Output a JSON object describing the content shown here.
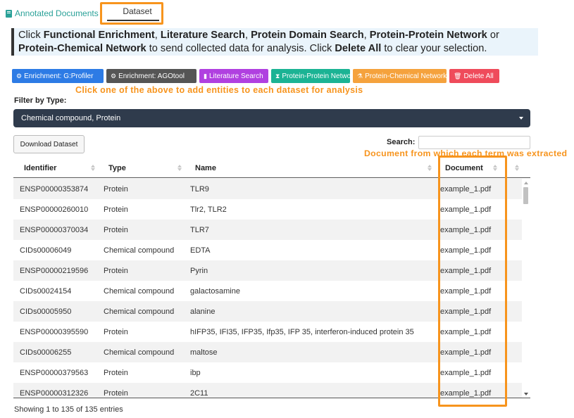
{
  "tabs": {
    "annotated_documents": "Annotated Documents",
    "dataset": "Dataset"
  },
  "info": {
    "p1": "Click ",
    "b1": "Functional Enrichment",
    "s1": ", ",
    "b2": "Literature Search",
    "s2": ", ",
    "b3": "Protein Domain Search",
    "s3": ", ",
    "b4": "Protein-Protein Network",
    "s4": " or ",
    "b5": "Protein-Chemical Network",
    "p2": " to send collected data for analysis. Click ",
    "b6": "Delete All",
    "p3": " to clear your selection."
  },
  "buttons": {
    "gprofiler": "Enrichment: G:Profiler",
    "agotool": "Enrichment: AGOtool",
    "literature": "Literature Search",
    "ppi": "Protein-Protein Network",
    "pci": "Protein-Chemical Network",
    "delete": "Delete All"
  },
  "hints": {
    "buttons": "Click one of the above to add entities to each dataset for analysis",
    "document": "Document from which each term was extracted"
  },
  "filter": {
    "label": "Filter by Type:",
    "value": "Chemical compound, Protein"
  },
  "download_label": "Download Dataset",
  "search_label": "Search:",
  "search_value": "",
  "columns": {
    "identifier": "Identifier",
    "type": "Type",
    "name": "Name",
    "document": "Document"
  },
  "rows": [
    {
      "id": "ENSP00000353874",
      "type": "Protein",
      "name": "TLR9",
      "doc": "example_1.pdf"
    },
    {
      "id": "ENSP00000260010",
      "type": "Protein",
      "name": "Tlr2, TLR2",
      "doc": "example_1.pdf"
    },
    {
      "id": "ENSP00000370034",
      "type": "Protein",
      "name": "TLR7",
      "doc": "example_1.pdf"
    },
    {
      "id": "CIDs00006049",
      "type": "Chemical compound",
      "name": "EDTA",
      "doc": "example_1.pdf"
    },
    {
      "id": "ENSP00000219596",
      "type": "Protein",
      "name": "Pyrin",
      "doc": "example_1.pdf"
    },
    {
      "id": "CIDs00024154",
      "type": "Chemical compound",
      "name": "galactosamine",
      "doc": "example_1.pdf"
    },
    {
      "id": "CIDs00005950",
      "type": "Chemical compound",
      "name": "alanine",
      "doc": "example_1.pdf"
    },
    {
      "id": "ENSP00000395590",
      "type": "Protein",
      "name": "hIFP35, IFI35, IFP35, Ifp35, IFP 35, interferon-induced protein 35",
      "doc": "example_1.pdf"
    },
    {
      "id": "CIDs00006255",
      "type": "Chemical compound",
      "name": "maltose",
      "doc": "example_1.pdf"
    },
    {
      "id": "ENSP00000379563",
      "type": "Protein",
      "name": "ibp",
      "doc": "example_1.pdf"
    },
    {
      "id": "ENSP00000312326",
      "type": "Protein",
      "name": "2C11",
      "doc": "example_1.pdf"
    }
  ],
  "footer": "Showing 1 to 135 of 135 entries",
  "colors": {
    "highlight": "#f7941d",
    "select_bg": "#2f3b4c"
  }
}
